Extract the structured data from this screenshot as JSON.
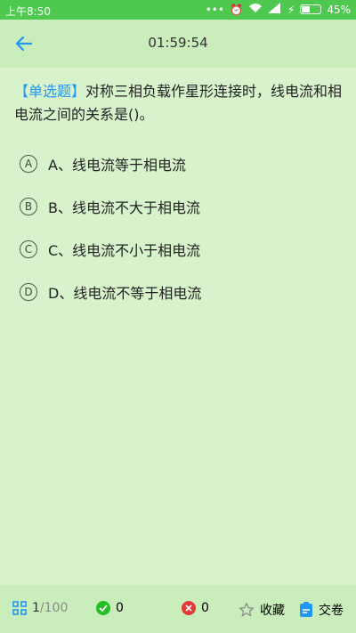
{
  "status_bar": {
    "time": "上午8:50",
    "battery_percent": "45%",
    "battery_level": 0.45
  },
  "header": {
    "timer": "01:59:54",
    "back_icon": "arrow-left-icon"
  },
  "question": {
    "type_label": "【单选题】",
    "text": "对称三相负载作星形连接时，线电流和相电流之间的关系是()。"
  },
  "options": [
    {
      "letter": "A",
      "text": "A、线电流等于相电流"
    },
    {
      "letter": "B",
      "text": "B、线电流不大于相电流"
    },
    {
      "letter": "C",
      "text": "C、线电流不小于相电流"
    },
    {
      "letter": "D",
      "text": "D、线电流不等于相电流"
    }
  ],
  "footer": {
    "progress_current": "1",
    "progress_total": "/100",
    "correct_count": "0",
    "wrong_count": "0",
    "favorite_label": "收藏",
    "submit_label": "交卷",
    "colors": {
      "correct": "#22c022",
      "wrong": "#e53935",
      "accent": "#2196f3"
    }
  }
}
